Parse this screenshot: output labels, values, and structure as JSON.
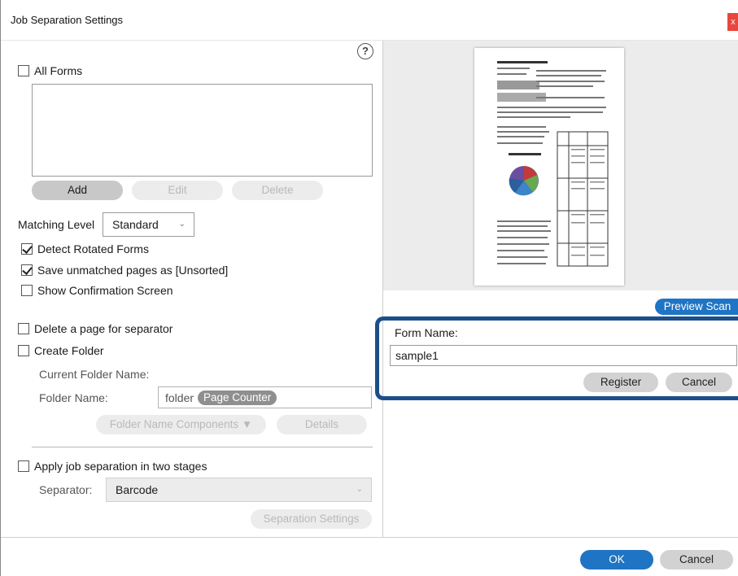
{
  "window": {
    "title": "Job Separation Settings",
    "close_glyph": "x"
  },
  "help": {
    "icon": "help-circle-icon",
    "glyph": "?"
  },
  "all_forms": {
    "label": "All Forms",
    "checked": false
  },
  "form_buttons": {
    "add": "Add",
    "edit": "Edit",
    "delete": "Delete"
  },
  "matching_level": {
    "label": "Matching Level",
    "value": "Standard"
  },
  "options": {
    "detect_rotated": {
      "label": "Detect Rotated Forms",
      "checked": true
    },
    "save_unmatched": {
      "label": "Save unmatched pages as [Unsorted]",
      "checked": true
    },
    "show_confirmation": {
      "label": "Show Confirmation Screen",
      "checked": false
    }
  },
  "delete_separator": {
    "label": "Delete a page for separator",
    "checked": false
  },
  "create_folder": {
    "label": "Create Folder",
    "checked": false
  },
  "folder": {
    "current_label": "Current Folder Name:",
    "name_label": "Folder Name:",
    "prefix": "folder",
    "chip": "Page Counter",
    "components_button": "Folder Name Components ▼",
    "details_button": "Details"
  },
  "two_stages": {
    "label": "Apply job separation in two stages",
    "checked": false
  },
  "separator": {
    "label": "Separator:",
    "value": "Barcode"
  },
  "separation_settings_button": "Separation Settings",
  "preview_scan_button": "Preview Scan",
  "form_name": {
    "label": "Form Name:",
    "value": "sample1"
  },
  "register_button": "Register",
  "cancel_button": "Cancel",
  "footer": {
    "ok": "OK",
    "cancel": "Cancel"
  },
  "colors": {
    "accent": "#1f74c4",
    "highlight": "#1c4f8a",
    "close": "#e8473c"
  }
}
